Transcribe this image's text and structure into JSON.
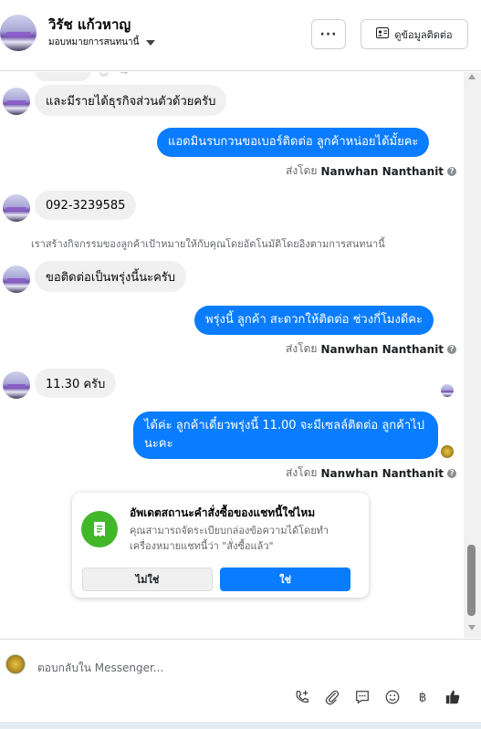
{
  "header": {
    "contact_name": "วิรัช แก้วหาญ",
    "assign_label": "มอบหมายการสนทนานี้",
    "more_label": "···",
    "contact_info_label": "ดูข้อมูลติดต่อ"
  },
  "thread": {
    "messages": [
      {
        "direction": "in",
        "text": "และมีรายได้ธุรกิจส่วนตัวด้วยครับ"
      },
      {
        "direction": "out",
        "text": "แอดมินรบกวนขอเบอร์ติดต่อ ลูกค้าหน่อยได้มั้ยคะ"
      },
      {
        "direction": "in",
        "text": "092-3239585"
      },
      {
        "direction": "in",
        "text": "ขอติดต่อเป็นพรุ่งนี้นะครับ"
      },
      {
        "direction": "out",
        "text": "พรุ่งนี้ ลูกค้า สะดวกให้ติดต่อ ช่วงกี่โมงดีคะ"
      },
      {
        "direction": "in",
        "text": "11.30 ครับ"
      },
      {
        "direction": "out",
        "text": "ได้ค่ะ ลูกค้าเดี๋ยวพรุ่งนี้ 11.00 จะมีเซลล์ติดต่อ ลูกค้าไปนะคะ"
      }
    ],
    "sent_by_prefix": "ส่งโดย",
    "sent_by_name": "Nanwhan Nanthanit",
    "activity_note": "เราสร้างกิจกรรมของลูกค้าเป้าหมายให้กับคุณโดยอัตโนมัติโดยอิงตามการสนทนานี้"
  },
  "order_card": {
    "title": "อัพเดตสถานะคำสั่งซื้อของแชทนี้ใช่ไหม",
    "description": "คุณสามารถจัดระเบียบกล่องข้อความได้โดยทำเครื่องหมายแชทนี้ว่า \"สั่งซื้อแล้ว\"",
    "no_label": "ไม่ใช่",
    "yes_label": "ใช่",
    "icon": "receipt-icon",
    "icon_color": "#42b72a"
  },
  "composer": {
    "placeholder": "ตอบกลับใน Messenger..."
  },
  "colors": {
    "accent": "#0a7cff",
    "incoming_bubble": "#f0f0f0"
  }
}
